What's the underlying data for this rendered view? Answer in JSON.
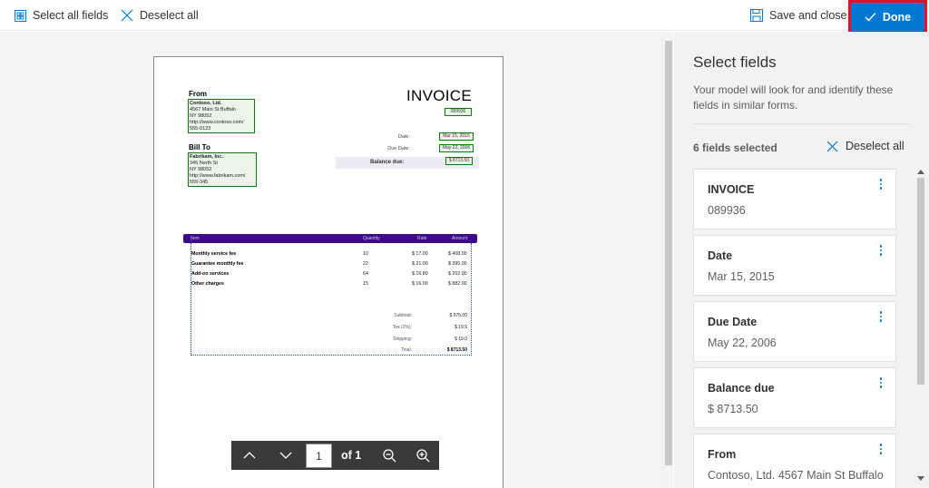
{
  "toolbar": {
    "select_all_label": "Select all fields",
    "deselect_all_label": "Deselect all",
    "save_close_label": "Save and close",
    "done_label": "Done"
  },
  "invoice_doc": {
    "from_heading": "From",
    "from_lines": [
      "Contoso, Ltd.",
      "4567 Main St Buffalo",
      "NY 98052",
      "http://www.contoso.com/",
      "555-0123"
    ],
    "billto_heading": "Bill To",
    "billto_lines": [
      "Fabrikam, Inc.",
      "345 North St",
      "NY 98052",
      "http://www.fabrikam.com/",
      "555-345"
    ],
    "title": "INVOICE",
    "invoice_no": "089936",
    "date_label": "Date:",
    "date_value": "Mar 15, 2015",
    "due_label": "Due Date:",
    "due_value": "May 22, 2006",
    "balance_label": "Balance due:",
    "balance_value": "$ 8713.50",
    "table_headers": {
      "item": "Item",
      "qty": "Quantity",
      "rate": "Rate",
      "amount": "Amount"
    },
    "rows": [
      {
        "name": "Monthly service fee",
        "qty": "10",
        "rate": "$ 17.00",
        "amount": "$ 408.00"
      },
      {
        "name": "Guarantee monthly fee",
        "qty": "22",
        "rate": "$ 21.00",
        "amount": "$ 395.00"
      },
      {
        "name": "Add-on services",
        "qty": "64",
        "rate": "$ 16.80",
        "amount": "$ 202.00"
      },
      {
        "name": "Other charges",
        "qty": "15",
        "rate": "$ 16.00",
        "amount": "$ 882.00"
      }
    ],
    "summary": [
      {
        "label": "Subtotal:",
        "value": "$ 975.00"
      },
      {
        "label": "Tax (2%):",
        "value": "$ 19.5"
      },
      {
        "label": "Shipping:",
        "value": "$ 19.0"
      },
      {
        "label": "Total:",
        "value": "$ 8713.50"
      }
    ]
  },
  "pager": {
    "current_page": "1",
    "of_label": "of 1"
  },
  "panel": {
    "title": "Select fields",
    "description": "Your model will look for and identify these fields in similar forms.",
    "count_label": "6 fields selected",
    "deselect_all_label": "Deselect all",
    "fields": [
      {
        "name": "INVOICE",
        "value": "089936"
      },
      {
        "name": "Date",
        "value": "Mar 15, 2015"
      },
      {
        "name": "Due Date",
        "value": "May 22, 2006"
      },
      {
        "name": "Balance due",
        "value": "$ 8713.50"
      },
      {
        "name": "From",
        "value": "Contoso, Ltd. 4567 Main St Buffalo"
      }
    ]
  },
  "colors": {
    "accent": "#0078d4",
    "highlight_border": "#e81123",
    "field_box": "#0e7a0d",
    "table_header": "#3e0a8c"
  }
}
